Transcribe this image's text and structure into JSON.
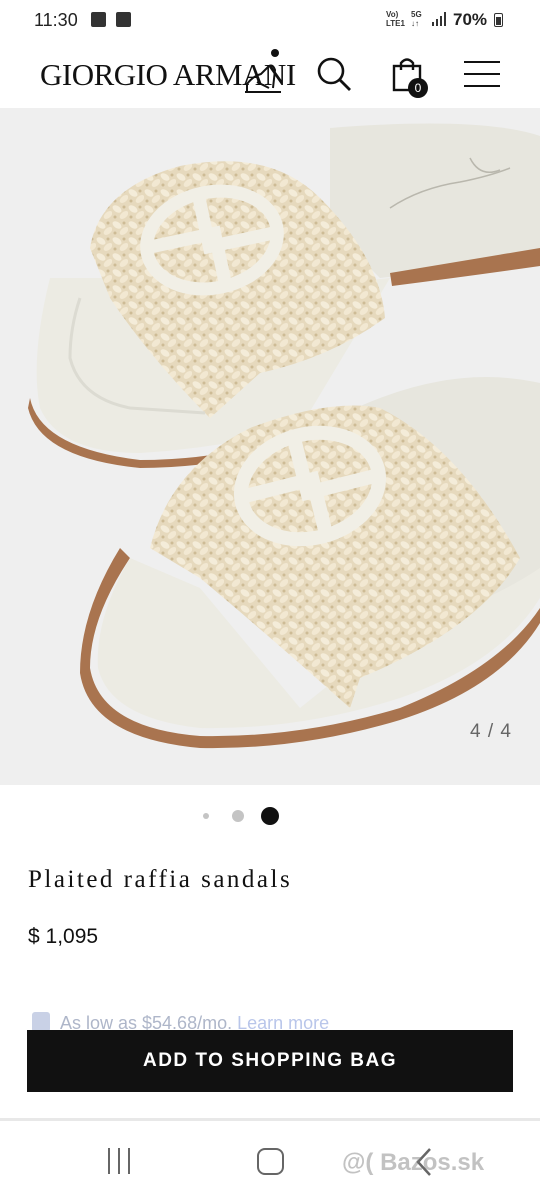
{
  "status_bar": {
    "time": "11:30",
    "network_top": "Vo)",
    "network_bottom": "LTE1",
    "gen": "5G",
    "battery": "70%"
  },
  "header": {
    "logo": "GIORGIO ARMANI",
    "bag_count": "0",
    "icons": [
      "search-icon",
      "shopping-bag-icon",
      "menu-icon"
    ]
  },
  "gallery": {
    "counter": "4 / 4",
    "current_slide": 3,
    "total_dots": 3
  },
  "product": {
    "title": "Plaited raffia sandals",
    "price": "$ 1,095",
    "installment_text": "As low as $54.68/mo.",
    "installment_link": "Learn more"
  },
  "actions": {
    "add_to_bag": "ADD TO SHOPPING BAG"
  },
  "watermark": "@( Bazos.sk",
  "colors": {
    "accent": "#111111",
    "gallery_bg": "#efefef",
    "raffia": "#e8dcc2",
    "leather": "#ecebe3",
    "sole_edge": "#a9744f"
  }
}
